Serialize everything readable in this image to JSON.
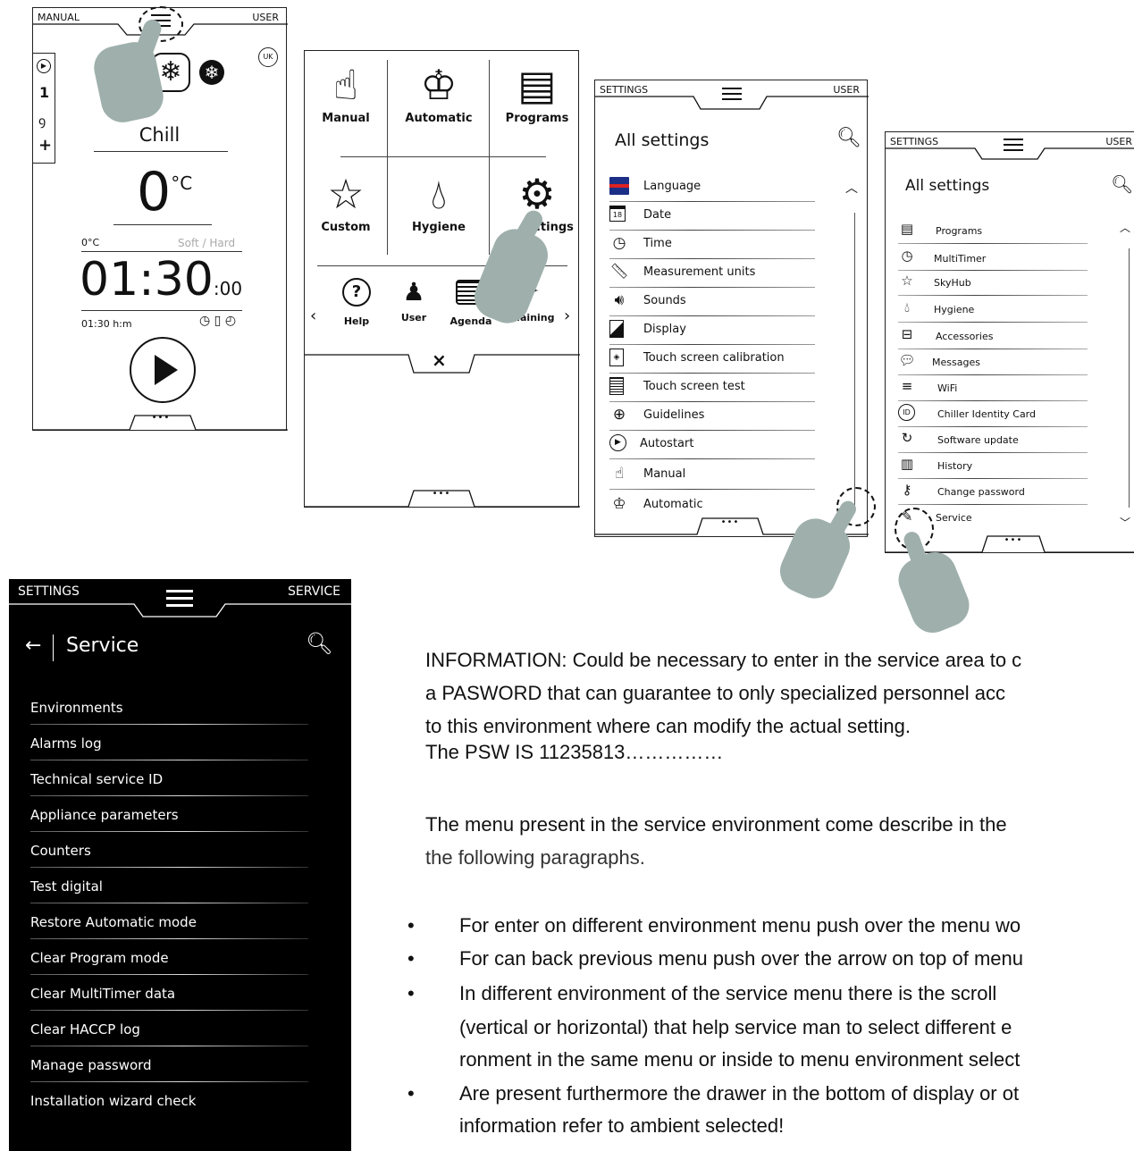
{
  "screen1": {
    "top_left": "MANUAL",
    "top_right": "USER",
    "uk_badge": "UK",
    "side_items": [
      "1",
      "+"
    ],
    "mode_label": "Chill",
    "temp_value": "0",
    "temp_unit": "°C",
    "probe_temp": "0°C",
    "soft_hard": "Soft / Hard",
    "time_big": "01:30",
    "time_sec": ":00",
    "time_small": "01:30 h:m",
    "drawer": "•••"
  },
  "screen2": {
    "tiles": [
      "Manual",
      "Automatic",
      "Programs",
      "Custom",
      "Hygiene",
      "...tings"
    ],
    "bottom_items": [
      "Help",
      "User",
      "Agenda",
      "...aining"
    ],
    "close": "×",
    "drawer": "•••"
  },
  "screen3": {
    "top_left": "SETTINGS",
    "top_right": "USER",
    "title": "All settings",
    "items": [
      "Language",
      "Date",
      "Time",
      "Measurement units",
      "Sounds",
      "Display",
      "Touch screen calibration",
      "Touch screen test",
      "Guidelines",
      "Autostart",
      "Manual",
      "Automatic"
    ],
    "date_num": "18",
    "drawer": "•••"
  },
  "screen4": {
    "top_left": "SETTINGS",
    "top_right": "USER",
    "title": "All settings",
    "items": [
      "Programs",
      "MultiTimer",
      "SkyHub",
      "Hygiene",
      "Accessories",
      "Messages",
      "WiFi",
      "Chiller Identity Card",
      "Software update",
      "History",
      "Change password",
      "Service"
    ],
    "id_badge": "ID",
    "drawer": "•••"
  },
  "service": {
    "top_left": "SETTINGS",
    "top_right": "SERVICE",
    "title": "Service",
    "items": [
      "Environments",
      "Alarms log",
      "Technical service ID",
      "Appliance parameters",
      "Counters",
      "Test digital",
      "Restore Automatic mode",
      "Clear Program mode",
      "Clear MultiTimer data",
      "Clear HACCP log",
      "Manage password",
      "Installation wizard check"
    ]
  },
  "doc": {
    "para1": [
      "INFORMATION: Could be necessary to enter in the service area to c",
      "a PASWORD that can guarantee to only specialized personnel acc",
      "to this environment where can modify the actual setting.",
      "The  PSW IS 11235813……………"
    ],
    "para2": [
      "The menu present in the service environment come describe in the",
      "the following paragraphs."
    ],
    "bullets": [
      [
        "For enter on different environment menu push over the menu wo"
      ],
      [
        "For can back previous menu push over the arrow on top of menu"
      ],
      [
        "In different environment of the service menu there is the scroll",
        "(vertical or horizontal) that help service man to select different e",
        "ronment in the same menu or inside to menu environment select"
      ],
      [
        "Are present furthermore the drawer in the bottom of display or ot",
        "information refer to ambient selected!"
      ]
    ],
    "bullet_char": "•"
  }
}
